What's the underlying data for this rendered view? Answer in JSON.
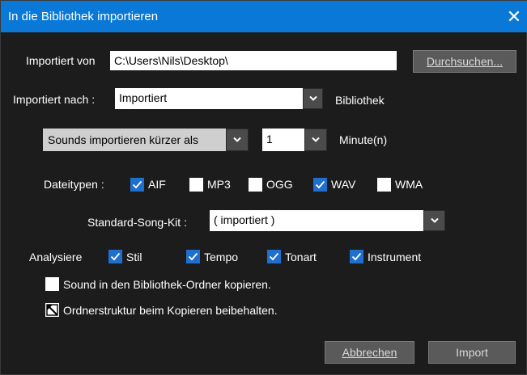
{
  "window": {
    "title": "In die Bibliothek importieren",
    "close_label": "✕"
  },
  "import_from": {
    "label": "Importiert von",
    "value": "C:\\Users\\Nils\\Desktop\\",
    "browse_label": "Durchsuchen..."
  },
  "import_to": {
    "label": "Importiert nach :",
    "value": "Importiert",
    "suffix": "Bibliothek"
  },
  "sounds": {
    "filter_value": "Sounds importieren kürzer als",
    "amount_value": "1",
    "unit": "Minute(n)"
  },
  "file_types": {
    "label": "Dateitypen :",
    "items": [
      {
        "label": "AIF",
        "checked": true
      },
      {
        "label": "MP3",
        "checked": false
      },
      {
        "label": "OGG",
        "checked": false
      },
      {
        "label": "WAV",
        "checked": true
      },
      {
        "label": "WMA",
        "checked": false
      }
    ]
  },
  "song_kit": {
    "label": "Standard-Song-Kit :",
    "value": "( importiert )"
  },
  "analyze": {
    "label": "Analysiere",
    "items": [
      {
        "label": "Stil",
        "checked": true
      },
      {
        "label": "Tempo",
        "checked": true
      },
      {
        "label": "Tonart",
        "checked": true
      },
      {
        "label": "Instrument",
        "checked": true
      }
    ]
  },
  "copy_option": {
    "label": "Sound in den Bibliothek-Ordner kopieren.",
    "checked": false
  },
  "keep_structure": {
    "label": "Ordnerstruktur beim Kopieren beibehalten.",
    "state": "indeterminate"
  },
  "footer": {
    "cancel_label": "Abbrechen",
    "import_label": "Import"
  }
}
